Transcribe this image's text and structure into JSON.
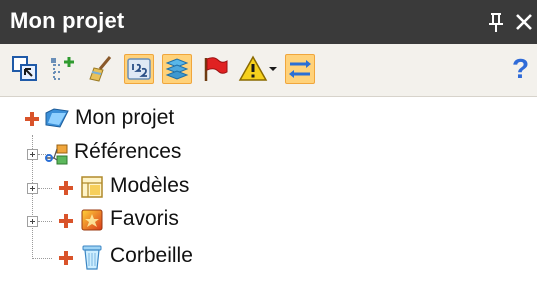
{
  "panel": {
    "title": "Mon projet",
    "pin_icon": "pin-icon",
    "close_icon": "close-icon"
  },
  "toolbar": {
    "buttons": [
      {
        "name": "view-mode-button",
        "icon": "view-mode-icon",
        "active": false
      },
      {
        "name": "add-tree-node-button",
        "icon": "add-node-icon",
        "active": false
      },
      {
        "name": "delete-button",
        "icon": "broom-icon",
        "active": false
      },
      {
        "name": "numbering-button",
        "icon": "numbering-icon",
        "active": true
      },
      {
        "name": "layers-button",
        "icon": "layers-icon",
        "active": true
      },
      {
        "name": "flag-button",
        "icon": "red-flag-icon",
        "active": false
      },
      {
        "name": "warnings-dropdown-button",
        "icon": "warning-icon",
        "active": false
      },
      {
        "name": "sync-button",
        "icon": "sync-arrows-icon",
        "active": true
      }
    ],
    "help_label": "?"
  },
  "tree": {
    "items": [
      {
        "label": "Mon projet",
        "icon": "project-folder-icon"
      },
      {
        "label": "Références",
        "icon": "references-icon"
      },
      {
        "label": "Modèles",
        "icon": "models-icon"
      },
      {
        "label": "Favoris",
        "icon": "favorites-icon"
      },
      {
        "label": "Corbeille",
        "icon": "recycle-bin-icon"
      }
    ]
  },
  "colors": {
    "titlebar": "#3a3a3a",
    "toolbar_bg": "#f3f1ec",
    "active_button": "#ffd27a",
    "help": "#2f6bd8"
  }
}
